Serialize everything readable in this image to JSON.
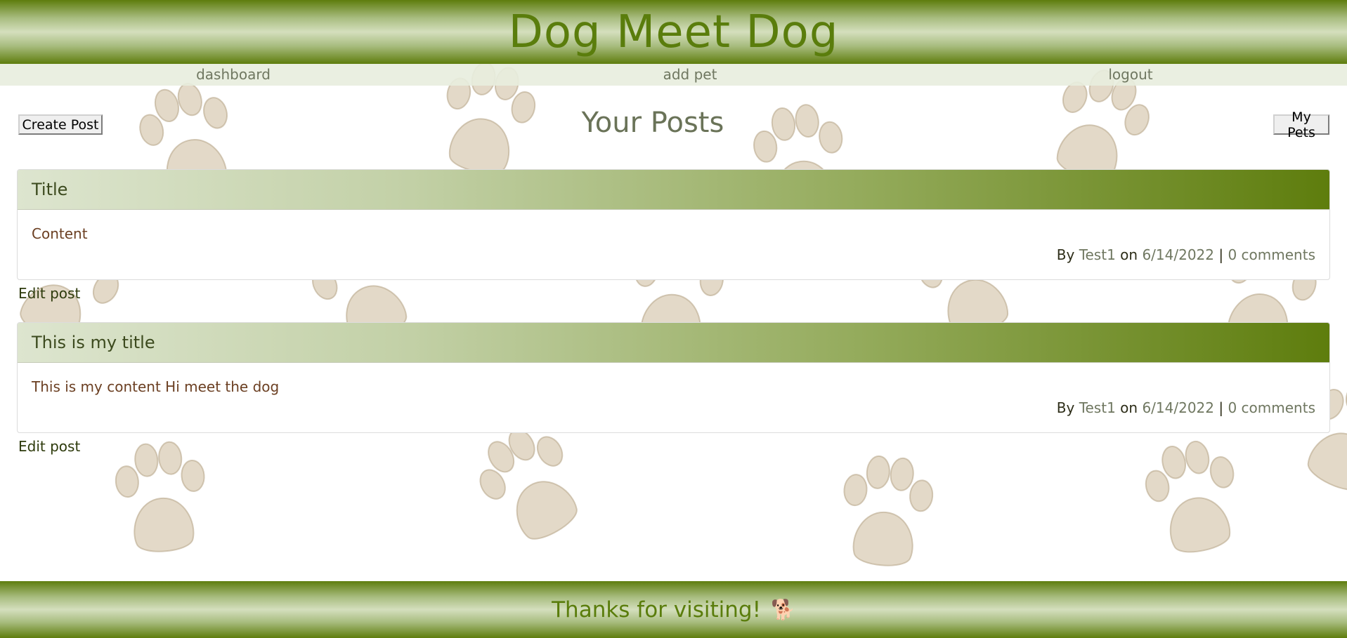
{
  "site": {
    "title": "Dog Meet Dog"
  },
  "nav": {
    "items": [
      {
        "label": "dashboard"
      },
      {
        "label": "add pet"
      },
      {
        "label": "logout"
      }
    ]
  },
  "toolbar": {
    "create_label": "Create Post",
    "page_title": "Your Posts",
    "pets_label": "My Pets"
  },
  "posts": [
    {
      "title": "Title",
      "content": "Content",
      "by": "By",
      "author": "Test1",
      "on": "on",
      "date": "6/14/2022",
      "sep": "|",
      "comments": "0 comments",
      "edit_label": "Edit post"
    },
    {
      "title": "This is my title",
      "content": "This is my content Hi meet the dog",
      "by": "By",
      "author": "Test1",
      "on": "on",
      "date": "6/14/2022",
      "sep": "|",
      "comments": "0 comments",
      "edit_label": "Edit post"
    }
  ],
  "footer": {
    "text": "Thanks for visiting!",
    "icon": "dog-icon",
    "icon_glyph": "🐕"
  },
  "colors": {
    "brand_green": "#5a7d0c",
    "muted_text": "#6f7760",
    "content_brown": "#6b3f22"
  }
}
